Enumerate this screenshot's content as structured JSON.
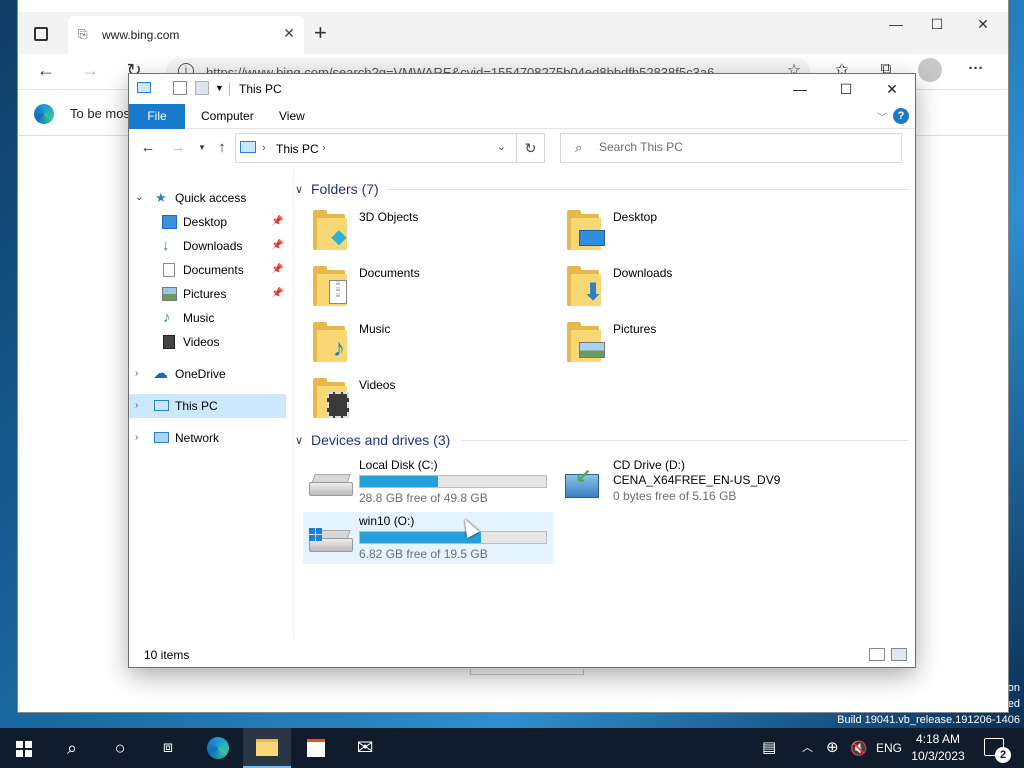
{
  "edge": {
    "tab_title": "www.bing.com",
    "tab_close": "✕",
    "new_tab": "+",
    "url": "https://www.bing.com/search?q=VMWARE&cvid=1554708275b04ed8bbdfb52838f5c3a6...",
    "info_text": "To be mos",
    "minimize": "—",
    "maximize": "☐",
    "close": "✕",
    "back": "←",
    "forward": "→",
    "refresh": "↻",
    "more": "···"
  },
  "explorer": {
    "title": "This PC",
    "minimize": "—",
    "maximize": "☐",
    "close": "✕",
    "ribbon_tabs": {
      "file": "File",
      "computer": "Computer",
      "view": "View"
    },
    "help": "?",
    "breadcrumb": "This PC",
    "search_placeholder": "Search This PC",
    "nav": {
      "quick_access": "Quick access",
      "desktop": "Desktop",
      "downloads": "Downloads",
      "documents": "Documents",
      "pictures": "Pictures",
      "music": "Music",
      "videos": "Videos",
      "onedrive": "OneDrive",
      "this_pc": "This PC",
      "network": "Network"
    },
    "folders_header": "Folders (7)",
    "folders": [
      "3D Objects",
      "Desktop",
      "Documents",
      "Downloads",
      "Music",
      "Pictures",
      "Videos"
    ],
    "drives_header": "Devices and drives (3)",
    "drives": {
      "c": {
        "name": "Local Disk (C:)",
        "free": "28.8 GB free of 49.8 GB",
        "used_fraction": 0.42
      },
      "d": {
        "name": "CD Drive (D:)",
        "label": "CENA_X64FREE_EN-US_DV9",
        "free": "0 bytes free of 5.16 GB"
      },
      "o": {
        "name": "win10 (O:)",
        "free": "6.82 GB free of 19.5 GB",
        "used_fraction": 0.65
      }
    },
    "status": "10 items"
  },
  "desktop": {
    "watermark_line1": "on",
    "watermark_line2": "ed",
    "build": "Build 19041.vb_release.191206-1406"
  },
  "taskbar": {
    "time": "4:18 AM",
    "date": "10/3/2023",
    "lang": "ENG",
    "notification_count": "2"
  },
  "colors": {
    "accent": "#1979ca",
    "selection": "#cce8ff",
    "drive_bar": "#26a0da",
    "taskbar": "#101c2b"
  }
}
